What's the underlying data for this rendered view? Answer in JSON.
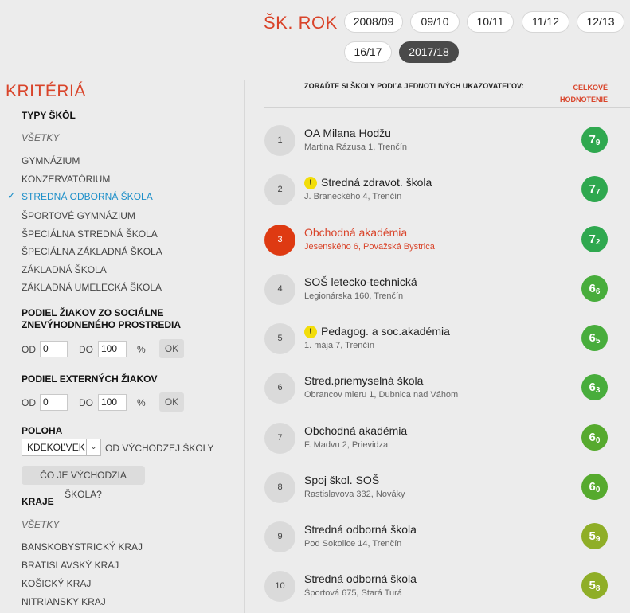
{
  "years": {
    "title": "ŠK. ROK",
    "items": [
      {
        "label": "2008/09"
      },
      {
        "label": "09/10"
      },
      {
        "label": "10/11"
      },
      {
        "label": "11/12"
      },
      {
        "label": "12/13"
      },
      {
        "label": "16/17"
      },
      {
        "label": "2017/18",
        "active": true
      }
    ]
  },
  "criteria": {
    "title": "KRITÉRIÁ",
    "school_types": {
      "heading": "TYPY ŠKÔL",
      "all": "VŠETKY",
      "items": [
        {
          "label": "GYMNÁZIUM"
        },
        {
          "label": "KONZERVATÓRIUM"
        },
        {
          "label": "STREDNÁ ODBORNÁ ŠKOLA",
          "selected": true
        },
        {
          "label": "ŠPORTOVÉ GYMNÁZIUM"
        },
        {
          "label": "ŠPECIÁLNA STREDNÁ ŠKOLA"
        },
        {
          "label": "ŠPECIÁLNA ZÁKLADNÁ ŠKOLA"
        },
        {
          "label": "ZÁKLADNÁ ŠKOLA"
        },
        {
          "label": "ZÁKLADNÁ UMELECKÁ ŠKOLA"
        }
      ],
      "check_icon": "check-icon"
    },
    "social": {
      "heading_line1": "PODIEL ŽIAKOV ZO SOCIÁLNE",
      "heading_line2": "ZNEVÝHODNENÉHO PROSTREDIA",
      "from_label": "OD",
      "from_value": "0",
      "to_label": "DO",
      "to_value": "100",
      "unit": "%",
      "ok": "OK"
    },
    "external": {
      "heading": "PODIEL EXTERNÝCH ŽIAKOV",
      "from_label": "OD",
      "from_value": "0",
      "to_label": "DO",
      "to_value": "100",
      "unit": "%",
      "ok": "OK"
    },
    "location": {
      "heading": "POLOHA",
      "select_value": "KDEKOĽVEK",
      "suffix": "OD VÝCHODZEJ ŠKOLY",
      "button": "ČO JE VÝCHODZIA ŠKOLA?"
    },
    "regions": {
      "heading": "KRAJE",
      "all": "VŠETKY",
      "items": [
        {
          "label": "BANSKOBYSTRICKÝ KRAJ"
        },
        {
          "label": "BRATISLAVSKÝ KRAJ"
        },
        {
          "label": "KOŠICKÝ KRAJ"
        },
        {
          "label": "NITRIANSKY KRAJ"
        }
      ]
    }
  },
  "list": {
    "sort_label": "ZORAĎTE SI ŠKOLY PODĽA JEDNOTLIVÝCH UKAZOVATEĽOV:",
    "score_label_line1": "CELKOVÉ",
    "score_label_line2": "HODNOTENIE",
    "schools": [
      {
        "rank": "1",
        "name": "OA Milana Hodžu",
        "address": "Martina Rázusa 1, Trenčín",
        "score_int": "7",
        "score_dec": "9",
        "color": "#2fa84f"
      },
      {
        "rank": "2",
        "name": "Stredná zdravot. škola",
        "address": "J. Braneckého 4, Trenčín",
        "score_int": "7",
        "score_dec": "7",
        "color": "#2fa84f",
        "warning": "!"
      },
      {
        "rank": "3",
        "name": "Obchodná akadémia",
        "address": "Jesenského 6, Považská Bystrica",
        "score_int": "7",
        "score_dec": "2",
        "color": "#2fa84f",
        "highlight": true
      },
      {
        "rank": "4",
        "name": "SOŠ letecko-technická",
        "address": "Legionárska 160, Trenčín",
        "score_int": "6",
        "score_dec": "6",
        "color": "#48ad3c"
      },
      {
        "rank": "5",
        "name": "Pedagog. a soc.akadémia",
        "address": "1. mája 7, Trenčín",
        "score_int": "6",
        "score_dec": "5",
        "color": "#48ad3c",
        "warning": "!"
      },
      {
        "rank": "6",
        "name": "Stred.priemyselná škola",
        "address": "Obrancov mieru 1, Dubnica nad Váhom",
        "score_int": "6",
        "score_dec": "3",
        "color": "#48ad3c"
      },
      {
        "rank": "7",
        "name": "Obchodná akadémia",
        "address": "F. Madvu 2, Prievidza",
        "score_int": "6",
        "score_dec": "0",
        "color": "#56aa2e"
      },
      {
        "rank": "8",
        "name": "Spoj škol. SOŠ",
        "address": "Rastislavova 332, Nováky",
        "score_int": "6",
        "score_dec": "0",
        "color": "#56aa2e"
      },
      {
        "rank": "9",
        "name": "Stredná odborná škola",
        "address": "Pod Sokolice 14, Trenčín",
        "score_int": "5",
        "score_dec": "9",
        "color": "#8fae27"
      },
      {
        "rank": "10",
        "name": "Stredná odborná škola",
        "address": "Športová 675, Stará Turá",
        "score_int": "5",
        "score_dec": "8",
        "color": "#8fae27"
      }
    ]
  }
}
